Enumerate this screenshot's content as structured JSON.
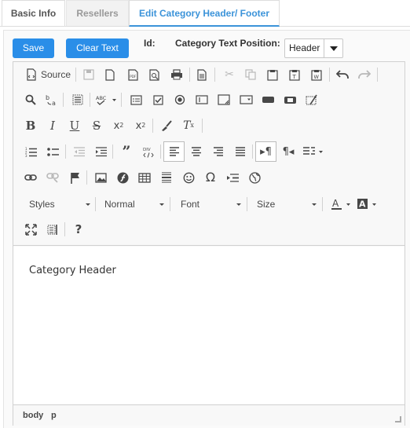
{
  "tabs": [
    {
      "label": "Basic Info"
    },
    {
      "label": "Resellers"
    },
    {
      "label": "Edit Category Header/ Footer"
    }
  ],
  "actions": {
    "save_label": "Save",
    "clear_label": "Clear Text"
  },
  "fields": {
    "id_label": "Id:",
    "position_label": "Category Text Position:",
    "position_value": "Header"
  },
  "toolbar": {
    "source_label": "Source",
    "styles_label": "Styles",
    "format_label": "Normal",
    "font_label": "Font",
    "size_label": "Size",
    "div_label": "DIV"
  },
  "content": {
    "text": "Category Header"
  },
  "status_path": [
    "body",
    "p"
  ],
  "colors": {
    "accent": "#2a8ee8",
    "active_tab": "#3b93d9"
  }
}
